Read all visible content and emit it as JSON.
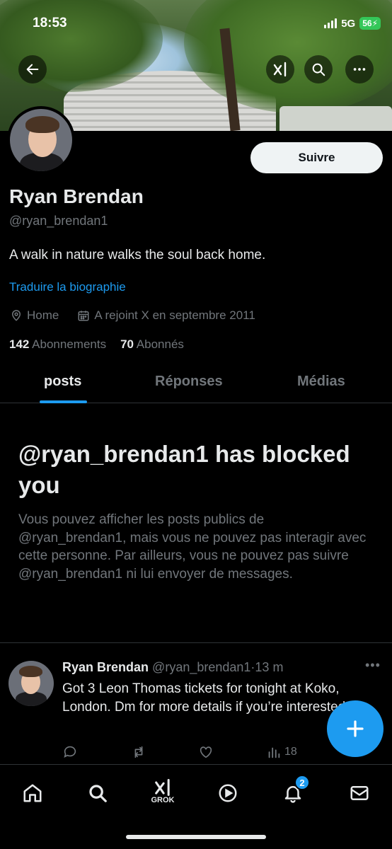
{
  "status_bar": {
    "time": "18:53",
    "network": "5G",
    "battery": "56"
  },
  "header": {
    "back_icon": "arrow-left-icon",
    "grok_icon": "grok-icon",
    "search_icon": "search-icon",
    "more_icon": "more-horizontal-icon"
  },
  "profile": {
    "follow_label": "Suivre",
    "name": "Ryan Brendan",
    "handle": "@ryan_brendan1",
    "bio": "A walk in nature walks the soul back home.",
    "translate_link": "Traduire la biographie",
    "location": "Home",
    "joined": "A rejoint X en septembre 2011",
    "following_count": "142",
    "following_label": "Abonnements",
    "followers_count": "70",
    "followers_label": "Abonnés"
  },
  "tabs": [
    {
      "label": "posts",
      "active": true
    },
    {
      "label": "Réponses",
      "active": false
    },
    {
      "label": "Médias",
      "active": false
    }
  ],
  "blocked": {
    "title": "@ryan_brendan1 has blocked you",
    "description": "Vous pouvez afficher les posts publics de @ryan_brendan1, mais vous ne pouvez pas interagir avec cette personne. Par ailleurs, vous ne pouvez pas suivre @ryan_brendan1 ni lui envoyer de messages."
  },
  "tweet": {
    "author_name": "Ryan Brendan",
    "author_handle": "@ryan_brendan1",
    "separator": "·",
    "time": "13 m",
    "text": "Got 3 Leon Thomas tickets for tonight at Koko, London. Dm for more details if you’re interested.",
    "views": "18"
  },
  "bottom_nav": {
    "grok_label": "GROK",
    "notifications_badge": "2"
  },
  "colors": {
    "accent": "#1d9bf0",
    "background": "#000000",
    "text_primary": "#e7e9ea",
    "text_secondary": "#71767b"
  }
}
